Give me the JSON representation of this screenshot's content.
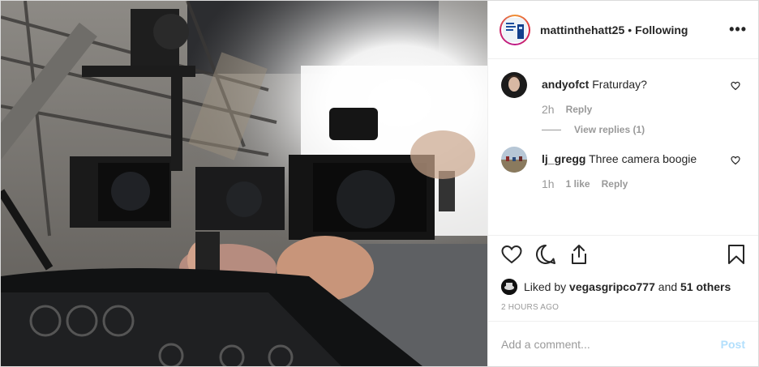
{
  "header": {
    "username": "mattinthehatt25",
    "separator": "•",
    "follow_status": "Following",
    "more_icon": "more-dots-icon"
  },
  "comments": [
    {
      "username": "andyofct",
      "text": "Fraturday?",
      "time": "2h",
      "reply_label": "Reply",
      "view_replies": "View replies (1)"
    },
    {
      "username": "lj_gregg",
      "text": "Three camera boogie",
      "time": "1h",
      "likes": "1 like",
      "reply_label": "Reply"
    }
  ],
  "likes": {
    "prefix": "Liked by ",
    "user": "vegasgripco777",
    "middle": " and ",
    "others": "51 others"
  },
  "timestamp": "2 HOURS AGO",
  "add_comment": {
    "placeholder": "Add a comment...",
    "post_label": "Post"
  },
  "colors": {
    "post_button_disabled": "#b2dffc",
    "muted_text": "#999999"
  }
}
